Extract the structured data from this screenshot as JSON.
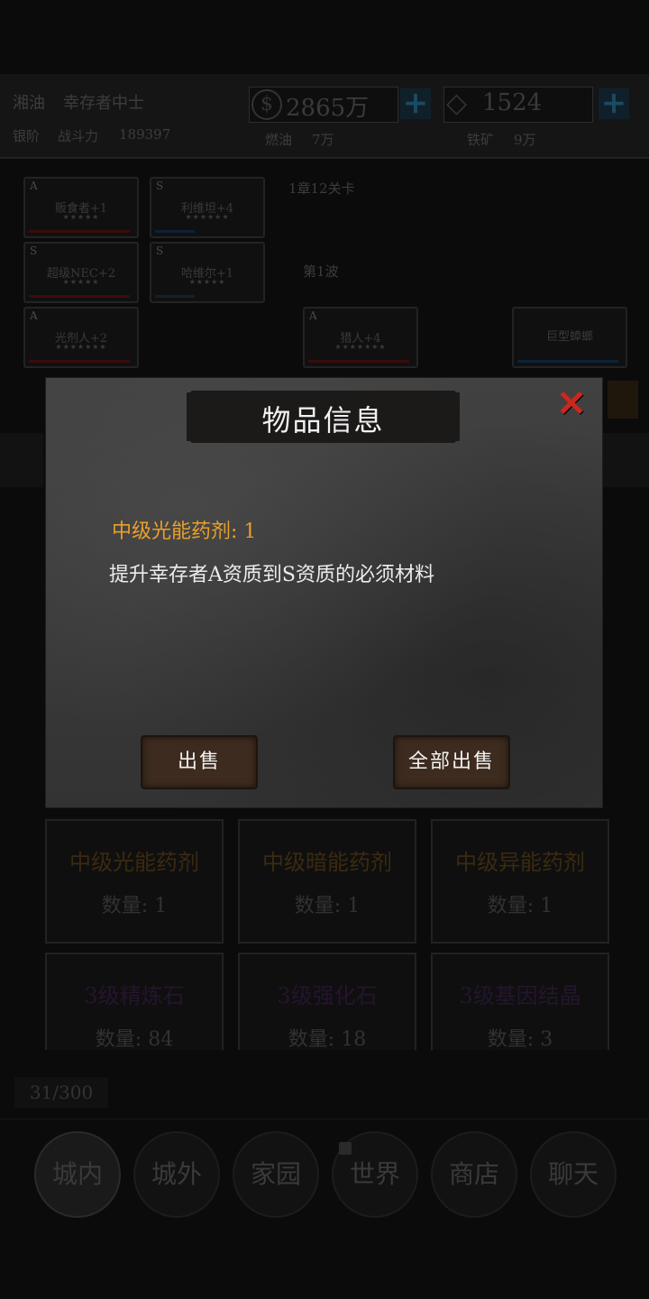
{
  "top": {
    "player_name": "湘油",
    "player_title": "幸存者中士",
    "power_label": "战斗力",
    "power_prefix": "银阶",
    "power_value": "189397",
    "gold": "2865万",
    "gold_sub_label": "燃油",
    "gold_sub_value": "7万",
    "diamond": "1524",
    "diamond_sub_label": "铁矿",
    "diamond_sub_value": "9万"
  },
  "squad": {
    "stage_text": "1章12关卡",
    "wave_text": "第1波",
    "cards": [
      {
        "grade": "A",
        "name": "贩食者+1",
        "stars": "★★★★★",
        "bar_color": "#5a1010"
      },
      {
        "grade": "S",
        "name": "利维坦+4",
        "stars": "★★★★★★",
        "bar_color": "#0f2c46"
      },
      {
        "grade": "S",
        "name": "超级NEC+2",
        "stars": "★★★★★",
        "bar_color": "#5a1010"
      },
      {
        "grade": "S",
        "name": "哈维尔+1",
        "stars": "★★★★★",
        "bar_color": "#0f2c46"
      },
      {
        "grade": "A",
        "name": "光剂人+2",
        "stars": "★★★★★★★",
        "bar_color": "#5a1010"
      },
      {
        "grade": "A",
        "name": "猎人+4",
        "stars": "★★★★★★★",
        "bar_color": "#5a1010"
      },
      {
        "grade": "",
        "name": "巨型蟑螂",
        "stars": "",
        "bar_color": "#0f2c46"
      }
    ]
  },
  "inventory": {
    "items": [
      {
        "name": "中级光能药剂",
        "qty": "数量: 1"
      },
      {
        "name": "中级暗能药剂",
        "qty": "数量: 1"
      },
      {
        "name": "中级异能药剂",
        "qty": "数量: 1"
      },
      {
        "name": "3级精炼石",
        "qty": "数量: 84"
      },
      {
        "name": "3级强化石",
        "qty": "数量: 18"
      },
      {
        "name": "3级基因结晶",
        "qty": "数量: 3"
      }
    ],
    "capacity": "31/300"
  },
  "tabs": [
    "城内",
    "城外",
    "家园",
    "世界",
    "商店",
    "聊天"
  ],
  "modal": {
    "title": "物品信息",
    "item_name": "中级光能药剂: 1",
    "item_desc": "提升幸存者A资质到S资质的必须材料",
    "sell_label": "出售",
    "sell_all_label": "全部出售"
  },
  "colors": {
    "item_name": "#e8a02a",
    "close": "#c9281f",
    "button": "#3d2b1f"
  }
}
